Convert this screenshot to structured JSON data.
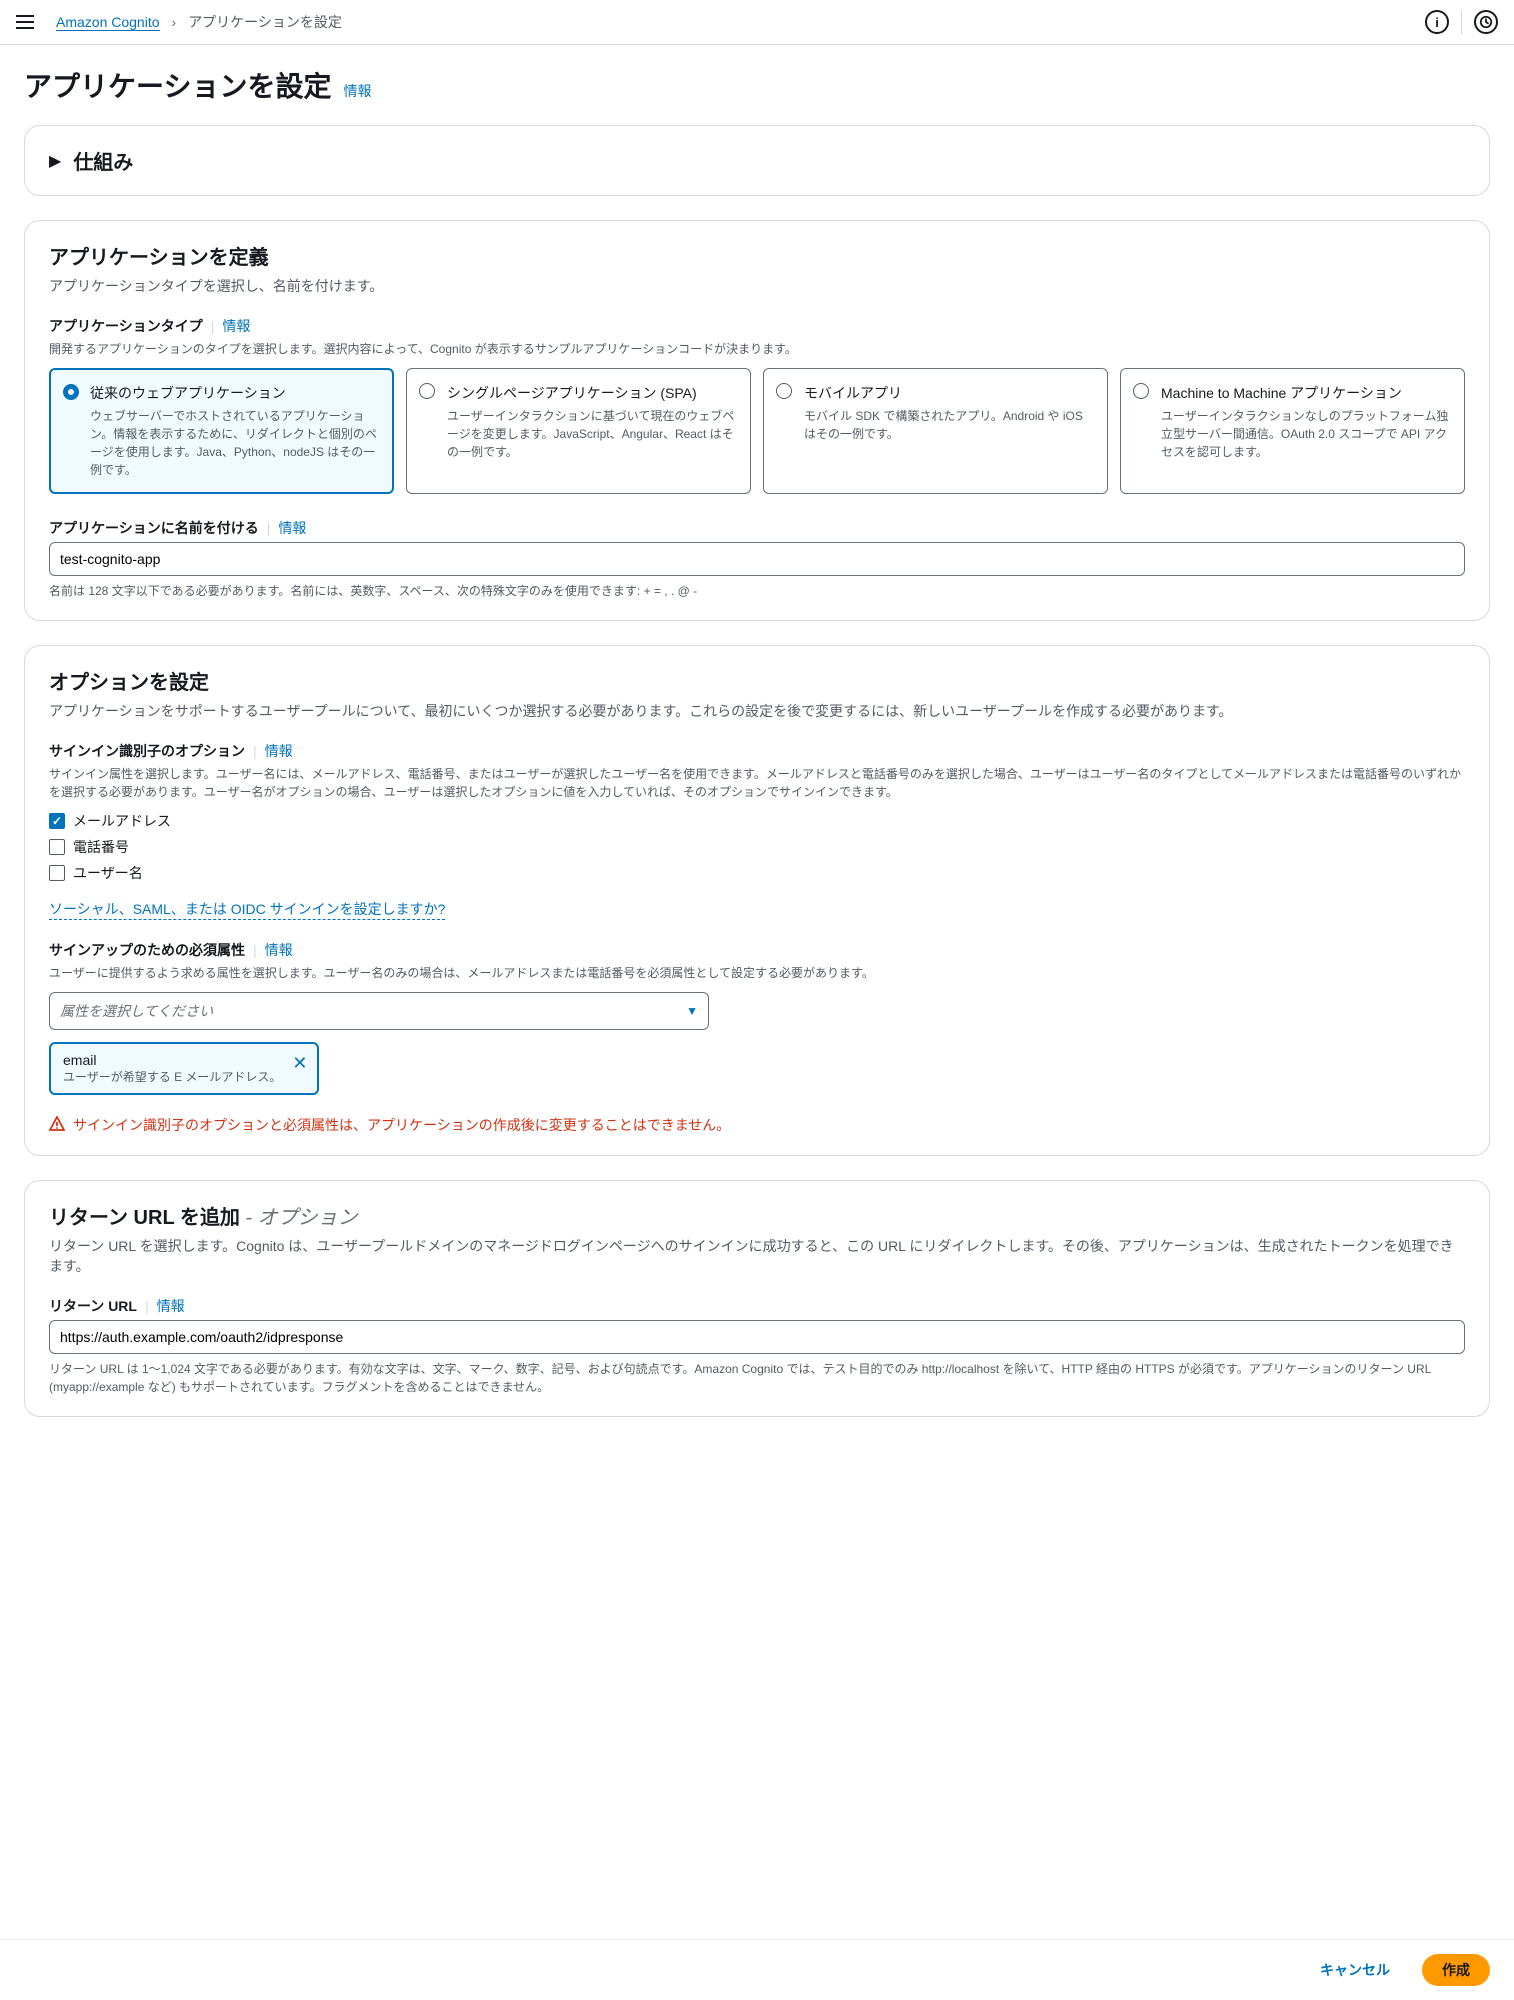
{
  "breadcrumb": {
    "service": "Amazon Cognito",
    "current": "アプリケーションを設定"
  },
  "page": {
    "title": "アプリケーションを設定",
    "info": "情報"
  },
  "expandable": {
    "howItWorks": "仕組み"
  },
  "define": {
    "title": "アプリケーションを定義",
    "desc": "アプリケーションタイプを選択し、名前を付けます。",
    "appType": {
      "label": "アプリケーションタイプ",
      "info": "情報",
      "desc": "開発するアプリケーションのタイプを選択します。選択内容によって、Cognito が表示するサンプルアプリケーションコードが決まります。",
      "tiles": [
        {
          "title": "従来のウェブアプリケーション",
          "desc": "ウェブサーバーでホストされているアプリケーション。情報を表示するために、リダイレクトと個別のページを使用します。Java、Python、nodeJS はその一例です。"
        },
        {
          "title": "シングルページアプリケーション (SPA)",
          "desc": "ユーザーインタラクションに基づいて現在のウェブページを変更します。JavaScript、Angular、React はその一例です。"
        },
        {
          "title": "モバイルアプリ",
          "desc": "モバイル SDK で構築されたアプリ。Android や iOS はその一例です。"
        },
        {
          "title": "Machine to Machine アプリケーション",
          "desc": "ユーザーインタラクションなしのプラットフォーム独立型サーバー間通信。OAuth 2.0 スコープで API アクセスを認可します。"
        }
      ]
    },
    "appName": {
      "label": "アプリケーションに名前を付ける",
      "info": "情報",
      "value": "test-cognito-app",
      "helper": "名前は 128 文字以下である必要があります。名前には、英数字、スペース、次の特殊文字のみを使用できます: + = , . @ -"
    }
  },
  "options": {
    "title": "オプションを設定",
    "desc": "アプリケーションをサポートするユーザープールについて、最初にいくつか選択する必要があります。これらの設定を後で変更するには、新しいユーザープールを作成する必要があります。",
    "signin": {
      "label": "サインイン識別子のオプション",
      "info": "情報",
      "desc": "サインイン属性を選択します。ユーザー名には、メールアドレス、電話番号、またはユーザーが選択したユーザー名を使用できます。メールアドレスと電話番号のみを選択した場合、ユーザーはユーザー名のタイプとしてメールアドレスまたは電話番号のいずれかを選択する必要があります。ユーザー名がオプションの場合、ユーザーは選択したオプションに値を入力していれば、そのオプションでサインインできます。",
      "items": [
        {
          "label": "メールアドレス",
          "checked": true
        },
        {
          "label": "電話番号",
          "checked": false
        },
        {
          "label": "ユーザー名",
          "checked": false
        }
      ]
    },
    "socialLink": "ソーシャル、SAML、または OIDC サインインを設定しますか?",
    "required": {
      "label": "サインアップのための必須属性",
      "info": "情報",
      "desc": "ユーザーに提供するよう求める属性を選択します。ユーザー名のみの場合は、メールアドレスまたは電話番号を必須属性として設定する必要があります。",
      "placeholder": "属性を選択してください",
      "chip": {
        "label": "email",
        "desc": "ユーザーが希望する E メールアドレス。"
      }
    },
    "warning": "サインイン識別子のオプションと必須属性は、アプリケーションの作成後に変更することはできません。"
  },
  "returnUrl": {
    "title": "リターン URL を追加",
    "optional": " - オプション",
    "desc": "リターン URL を選択します。Cognito は、ユーザープールドメインのマネージドログインページへのサインインに成功すると、この URL にリダイレクトします。その後、アプリケーションは、生成されたトークンを処理できます。",
    "label": "リターン URL",
    "info": "情報",
    "value": "https://auth.example.com/oauth2/idpresponse",
    "helper": "リターン URL は 1〜1,024 文字である必要があります。有効な文字は、文字、マーク、数字、記号、および句読点です。Amazon Cognito では、テスト目的でのみ http://localhost を除いて、HTTP 経由の HTTPS が必須です。アプリケーションのリターン URL (myapp://example など) もサポートされています。フラグメントを含めることはできません。"
  },
  "footer": {
    "cancel": "キャンセル",
    "create": "作成"
  }
}
